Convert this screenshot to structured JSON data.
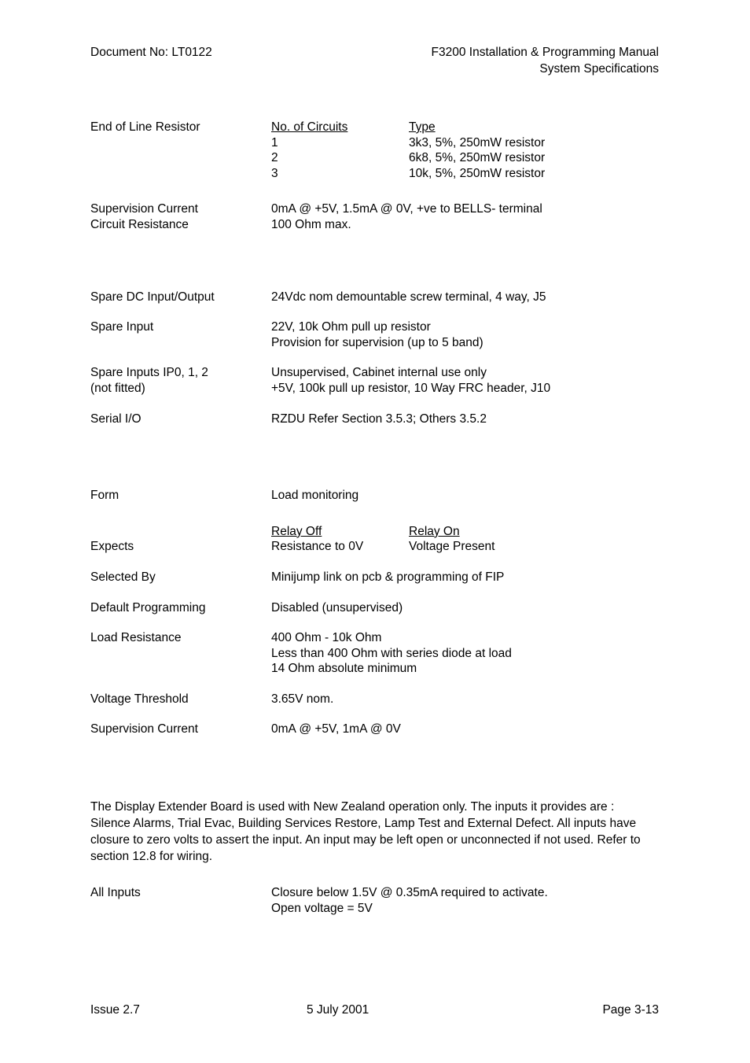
{
  "header": {
    "document_no": "Document No: LT0122",
    "manual_title": "F3200 Installation & Programming Manual",
    "section_title": "System Specifications"
  },
  "sections": [
    {
      "name": "bells-circuit",
      "eol_resistor": {
        "label": "End of Line Resistor",
        "col_header_circuits": "No. of Circuits",
        "col_header_type": "Type",
        "rows": [
          {
            "circuits": "1",
            "type": "3k3, 5%, 250mW resistor"
          },
          {
            "circuits": "2",
            "type": "6k8, 5%, 250mW resistor"
          },
          {
            "circuits": "3",
            "type": "10k, 5%, 250mW resistor"
          }
        ]
      },
      "supervision_current": {
        "label": "Supervision Current",
        "value": "0mA @ +5V, 1.5mA @ 0V, +ve to BELLS- terminal"
      },
      "circuit_resistance": {
        "label": "Circuit Resistance",
        "value": "100 Ohm max."
      }
    },
    {
      "name": "spare-io",
      "spare_dc_io": {
        "label": "Spare DC Input/Output",
        "value": "24Vdc nom demountable screw terminal, 4 way, J5"
      },
      "spare_input": {
        "label": "Spare Input",
        "value_line1": "22V, 10k Ohm pull up resistor",
        "value_line2": "Provision for supervision (up to 5 band)"
      },
      "spare_inputs_ip": {
        "label_line1": "Spare Inputs IP0, 1, 2",
        "label_line2": "(not fitted)",
        "value_line1": "Unsupervised, Cabinet internal use only",
        "value_line2": "+5V, 100k pull up resistor, 10 Way FRC header, J10"
      },
      "serial_io": {
        "label": "Serial I/O",
        "value": "RZDU Refer Section 3.5.3; Others 3.5.2"
      }
    },
    {
      "name": "load-monitoring",
      "form": {
        "label": "Form",
        "value": "Load monitoring"
      },
      "expects": {
        "label": "Expects",
        "col_header_relay_off": "Relay Off",
        "col_header_relay_on": "Relay On",
        "relay_off_value": "Resistance to 0V",
        "relay_on_value": "Voltage Present"
      },
      "selected_by": {
        "label": "Selected By",
        "value": "Minijump link on pcb & programming of FIP"
      },
      "default_programming": {
        "label": "Default Programming",
        "value": "Disabled (unsupervised)"
      },
      "load_resistance": {
        "label": "Load Resistance",
        "value_line1": "400 Ohm - 10k Ohm",
        "value_line2": "Less than 400 Ohm with series diode at load",
        "value_line3": "14 Ohm absolute minimum"
      },
      "voltage_threshold": {
        "label": "Voltage Threshold",
        "value": "3.65V nom."
      },
      "supervision_current": {
        "label": "Supervision Current",
        "value": "0mA @ +5V, 1mA @ 0V"
      }
    },
    {
      "name": "display-extender-board",
      "paragraph": "The Display Extender Board is used with New Zealand operation only.  The inputs it provides are : Silence Alarms, Trial Evac, Building Services Restore, Lamp Test and External Defect.  All inputs have closure to zero volts to assert the input.  An input may be left open or unconnected if not used.  Refer to section 12.8 for wiring.",
      "all_inputs": {
        "label": "All Inputs",
        "value_line1": "Closure below 1.5V @ 0.35mA required to activate.",
        "value_line2": "Open voltage = 5V"
      }
    }
  ],
  "footer": {
    "issue": "Issue 2.7",
    "date": "5 July 2001",
    "page": "Page 3-13"
  }
}
